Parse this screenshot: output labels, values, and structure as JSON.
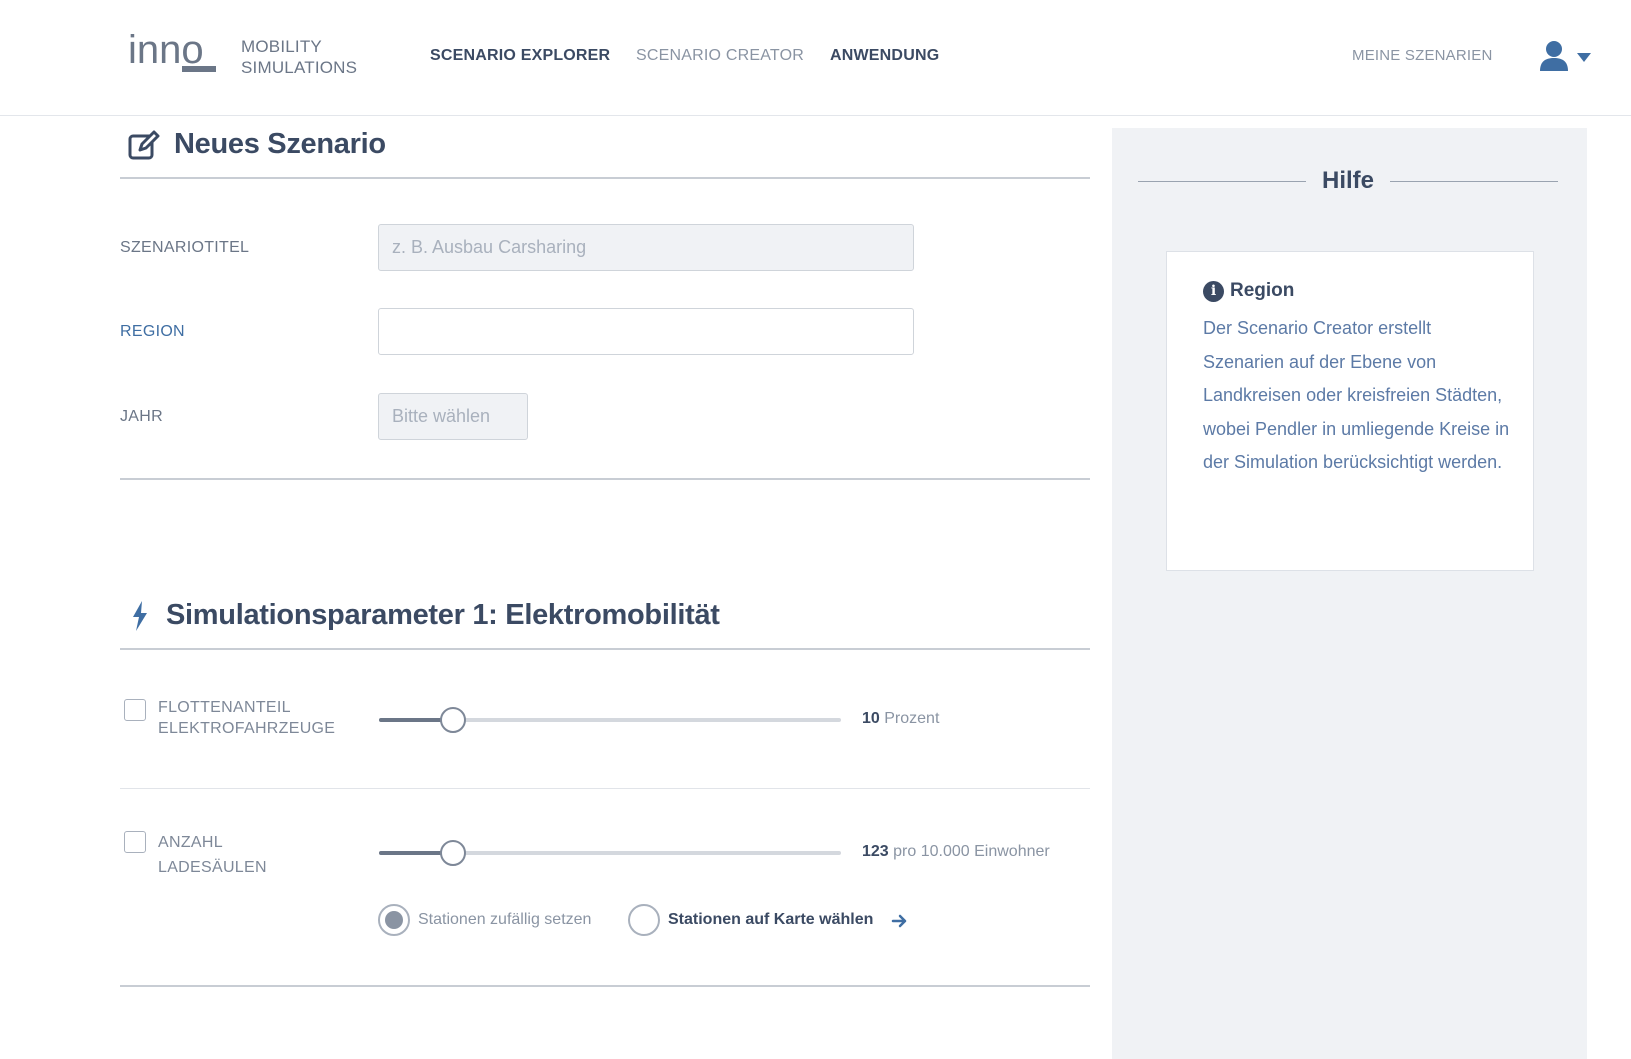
{
  "header": {
    "logo_text": "inno",
    "brand_line1": "MOBILITY",
    "brand_line2": "SIMULATIONS",
    "nav": [
      {
        "label": "SCENARIO EXPLORER",
        "state": "active"
      },
      {
        "label": "SCENARIO CREATOR",
        "state": "inactive"
      },
      {
        "label": "ANWENDUNG",
        "state": "active"
      }
    ],
    "my_scenarios": "MEINE SZENARIEN",
    "user_icon": "user-icon"
  },
  "scenario": {
    "title": "Neues Szenario",
    "title_icon": "edit-icon",
    "fields": {
      "title_label": "SZENARIOTITEL",
      "title_placeholder": "z. B. Ausbau Carsharing",
      "region_label": "REGION",
      "region_value": "",
      "year_label": "JAHR",
      "year_placeholder": "Bitte wählen"
    }
  },
  "params": {
    "title": "Simulationsparameter 1: Elektromobilität",
    "title_icon": "bolt-icon",
    "fleet": {
      "label_line1": "FLOTTENANTEIL",
      "label_line2": "ELEKTROFAHRZEUGE",
      "checked": false,
      "value": "10",
      "unit": "Prozent",
      "slider_fraction": 0.16
    },
    "chargers": {
      "label_line1": "ANZAHL",
      "label_line2": "LADESÄULEN",
      "checked": false,
      "value": "123",
      "unit": "pro 10.000 Einwohner",
      "slider_fraction": 0.16,
      "options": [
        {
          "label": "Stationen zufällig setzen",
          "checked": true
        },
        {
          "label": "Stationen auf Karte wählen",
          "checked": false
        }
      ]
    }
  },
  "help": {
    "title": "Hilfe",
    "card_title": "Region",
    "card_text": "Der Scenario Creator erstellt Szenarien auf der Ebene von Landkreisen oder kreisfreien Städten, wobei Pendler in umliegende Kreise in der Simulation berücksichtigt werden."
  },
  "colors": {
    "primary": "#3b4a63",
    "accent": "#3f6ea3",
    "muted": "#8a94a3",
    "sidebar_bg": "#f0f2f5"
  }
}
